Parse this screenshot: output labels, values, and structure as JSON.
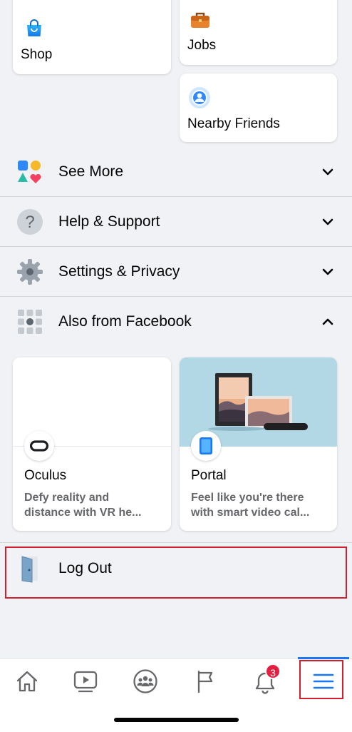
{
  "shortcuts": {
    "shop_label": "Shop",
    "jobs_label": "Jobs",
    "nearby_friends_label": "Nearby Friends"
  },
  "menu": {
    "see_more": "See More",
    "help_support": "Help & Support",
    "settings_privacy": "Settings & Privacy",
    "also_from_facebook": "Also from Facebook"
  },
  "also_from_facebook": {
    "oculus": {
      "title": "Oculus",
      "desc_line1": "Defy reality and",
      "desc_line2": "distance with VR he..."
    },
    "portal": {
      "title": "Portal",
      "desc_line1": "Feel like you're there",
      "desc_line2": "with smart video cal..."
    }
  },
  "logout": {
    "label": "Log Out"
  },
  "tabbar": {
    "items": [
      "home-icon",
      "watch-icon",
      "groups-icon",
      "pages-flag-icon",
      "notifications-bell-icon",
      "menu-icon"
    ],
    "notification_count": "3",
    "active_tab": "menu"
  },
  "colors": {
    "background": "#f0f2f5",
    "accent": "#1877f2",
    "badge": "#e41e3f",
    "highlight": "#d32030"
  }
}
